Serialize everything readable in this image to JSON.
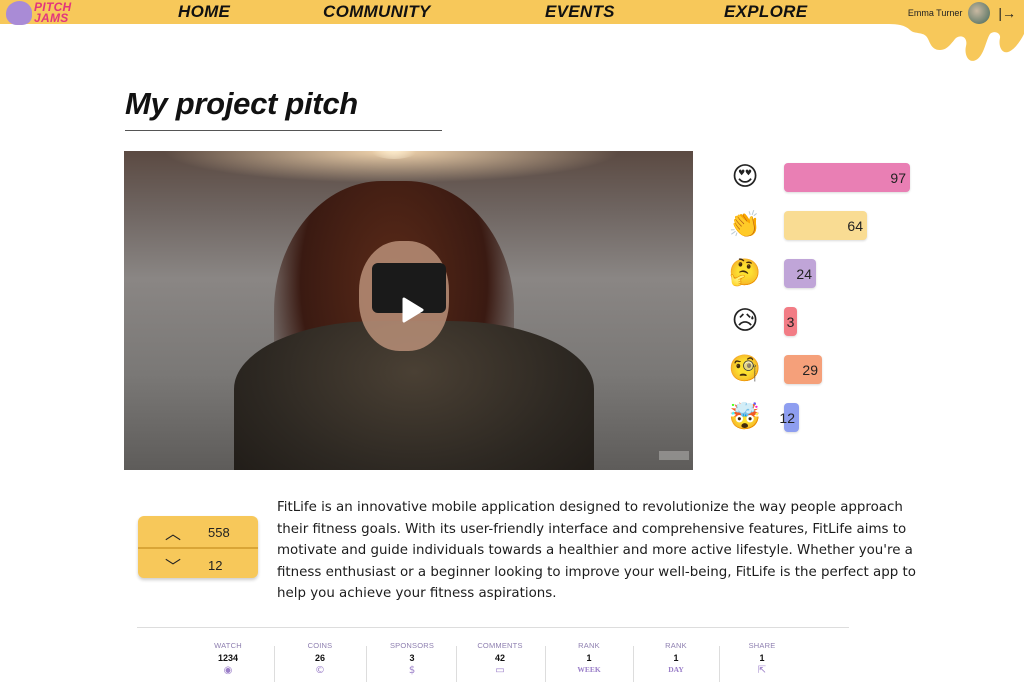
{
  "header": {
    "logo_line1": "PITCH",
    "logo_line2": "JAMS",
    "nav": [
      "HOME",
      "COMMUNITY",
      "EVENTS",
      "EXPLORE"
    ],
    "user_name": "Emma Turner",
    "logout_glyph": "|→"
  },
  "page": {
    "title": "My project pitch"
  },
  "reactions": [
    {
      "icon": "heart-eyes-icon",
      "glyph": "😍",
      "count": "97",
      "fraction": 1.0,
      "color": "#e97fb4"
    },
    {
      "icon": "clapping-hands-icon",
      "glyph": "👏",
      "count": "64",
      "fraction": 0.66,
      "color": "#f9dc93"
    },
    {
      "icon": "thinking-face-icon",
      "glyph": "🤔",
      "count": "24",
      "fraction": 0.25,
      "color": "#c0a5d8"
    },
    {
      "icon": "sad-tear-face-icon",
      "glyph": "😥",
      "count": "3",
      "fraction": 0.03,
      "color": "#f27c85"
    },
    {
      "icon": "monocle-face-icon",
      "glyph": "🧐",
      "count": "29",
      "fraction": 0.3,
      "color": "#f5a07a"
    },
    {
      "icon": "exploding-head-icon",
      "glyph": "🤯",
      "count": "12",
      "fraction": 0.12,
      "color": "#8e9ef0"
    }
  ],
  "vote": {
    "up_count": "558",
    "down_count": "12"
  },
  "description": "FitLife is an innovative mobile application designed to revolutionize the way people approach their fitness goals. With its user-friendly interface and comprehensive features, FitLife aims to motivate and guide individuals towards a healthier and more active lifestyle. Whether you're a fitness enthusiast or a beginner looking to improve your well-being, FitLife is the perfect app to help you achieve your fitness aspirations.",
  "stats": [
    {
      "label": "WATCH",
      "value": "1234",
      "icon": "eye-icon",
      "glyph": "◉"
    },
    {
      "label": "COINS",
      "value": "26",
      "icon": "coin-icon",
      "glyph": "©"
    },
    {
      "label": "SPONSORS",
      "value": "3",
      "icon": "dollar-icon",
      "glyph": "$"
    },
    {
      "label": "COMMENTS",
      "value": "42",
      "icon": "comment-icon",
      "glyph": "▭"
    },
    {
      "label": "RANK",
      "value": "1",
      "sub": "WEEK"
    },
    {
      "label": "RANK",
      "value": "1",
      "sub": "DAY"
    },
    {
      "label": "SHARE",
      "value": "1",
      "icon": "share-icon",
      "glyph": "⇱"
    }
  ],
  "colors": {
    "brand_yellow": "#f7c85a",
    "brand_pink": "#e2357d",
    "accent_purple": "#a98bd6"
  }
}
